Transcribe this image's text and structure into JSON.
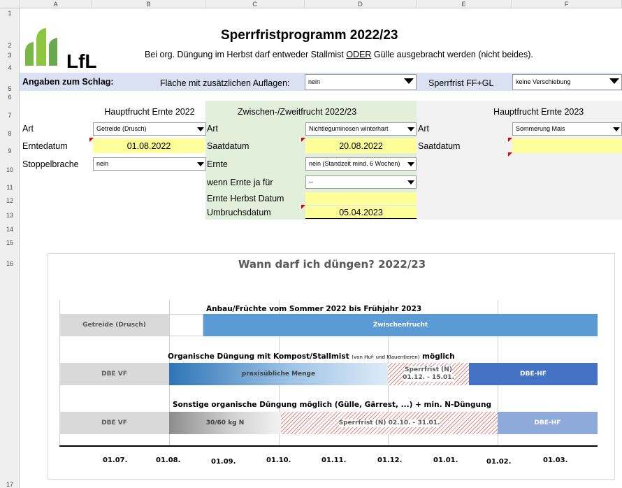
{
  "spreadsheet": {
    "columns": [
      "A",
      "B",
      "C",
      "D",
      "E",
      "F"
    ],
    "rows": [
      "1",
      "2",
      "3",
      "4",
      "5",
      "6",
      "7",
      "8",
      "9",
      "10",
      "11",
      "12",
      "13",
      "14",
      "15",
      "16",
      "17"
    ]
  },
  "header": {
    "logo_text": "LfL",
    "title": "Sperrfristprogramm 2022/23",
    "subtitle_pre": "Bei org. Düngung im Herbst darf entweder Stallmist ",
    "subtitle_em": "ODER",
    "subtitle_post": " Gülle ausgebracht werden (nicht beides)."
  },
  "schlag": {
    "label": "Angaben zum Schlag:",
    "auflagen_label": "Fläche mit zusätzlichen Auflagen:",
    "auflagen_value": "nein",
    "sperrfrist_label": "Sperrfrist FF+GL",
    "sperrfrist_value": "keine Verschiebung"
  },
  "hauptfrucht_2022": {
    "heading": "Hauptfrucht Ernte 2022",
    "art_label": "Art",
    "art_value": "Getreide (Drusch)",
    "erntedatum_label": "Erntedatum",
    "erntedatum_value": "01.08.2022",
    "stoppel_label": "Stoppelbrache",
    "stoppel_value": "nein"
  },
  "zwischenfrucht": {
    "heading": "Zwischen-/Zweitfrucht 2022/23",
    "art_label": "Art",
    "art_value": "Nichtleguminosen winterhart",
    "saatdatum_label": "Saatdatum",
    "saatdatum_value": "20.08.2022",
    "ernte_label": "Ernte",
    "ernte_value": "nein (Standzeit mind. 6 Wochen)",
    "wenn_label": "wenn Ernte ja für",
    "wenn_value": "--",
    "ernte_herbst_label": "Ernte Herbst Datum",
    "ernte_herbst_value": "",
    "umbruch_label": "Umbruchsdatum",
    "umbruch_value": "05.04.2023"
  },
  "hauptfrucht_2023": {
    "heading": "Hauptfrucht Ernte 2023",
    "art_label": "Art",
    "art_value": "Sommerung Mais",
    "saatdatum_label": "Saatdatum",
    "saatdatum_value": ""
  },
  "chart": {
    "title": "Wann darf ich düngen? 2022/23",
    "section1_title": "Anbau/Früchte vom Sommer 2022 bis Frühjahr 2023",
    "section2_title_main": "Organische Düngung mit Kompost/Stallmist ",
    "section2_title_small": "(von Huf- und Klauentieren)",
    "section2_title_end": " möglich",
    "section3_title": "Sonstige organische Düngung möglich (Gülle, Gärrest, ...) + min. N-Düngung",
    "x_ticks": [
      "01.07.",
      "01.08.",
      "01.09.",
      "01.10.",
      "01.11.",
      "01.12.",
      "01.01.",
      "01.02.",
      "01.03."
    ]
  },
  "chart_data": {
    "type": "gantt",
    "title": "Wann darf ich düngen? 2022/23",
    "x_ticks": [
      "01.07.",
      "01.08.",
      "01.09.",
      "01.10.",
      "01.11.",
      "01.12.",
      "01.01.",
      "01.02.",
      "01.03."
    ],
    "rows": [
      {
        "title": "Anbau/Früchte vom Sommer 2022 bis Frühjahr 2023",
        "segments": [
          {
            "label": "Getreide (Drusch)",
            "start": "01.06.",
            "end": "01.08.",
            "color": "#d9d9d9"
          },
          {
            "label": "",
            "start": "01.08.",
            "end": "20.08.",
            "color": "#ffffff"
          },
          {
            "label": "Zwischenfrucht",
            "start": "20.08.",
            "end": "end",
            "color": "#5b9bd5"
          }
        ]
      },
      {
        "title": "Organische Düngung mit Kompost/Stallmist (von Huf- und Klauentieren) möglich",
        "segments": [
          {
            "label": "DBE VF",
            "start": "01.06.",
            "end": "01.08.",
            "color": "#d9d9d9"
          },
          {
            "label": "praxisübliche Menge",
            "start": "01.08.",
            "end": "01.12.",
            "color": "#2e75b6"
          },
          {
            "label": "Sperrfrist (N) 01.12. - 15.01.",
            "start": "01.12.",
            "end": "15.01.",
            "color": "#e38888"
          },
          {
            "label": "DBE-HF",
            "start": "15.01.",
            "end": "end",
            "color": "#4472c4"
          }
        ]
      },
      {
        "title": "Sonstige organische Düngung möglich (Gülle, Gärrest, ...) + min. N-Düngung",
        "segments": [
          {
            "label": "DBE VF",
            "start": "01.06.",
            "end": "01.08.",
            "color": "#d9d9d9"
          },
          {
            "label": "30/60 kg N",
            "start": "01.08.",
            "end": "01.10.",
            "color": "#a6a6a6"
          },
          {
            "label": "Sperrfrist (N) 02.10. - 31.01.",
            "start": "02.10.",
            "end": "31.01.",
            "color": "#e38888"
          },
          {
            "label": "DBE-HF",
            "start": "01.02.",
            "end": "end",
            "color": "#8eaadb"
          }
        ]
      }
    ],
    "labels": {
      "r1_a": "Getreide (Drusch)",
      "r1_c": "Zwischenfrucht",
      "r2_a": "DBE VF",
      "r2_b": "praxisübliche Menge",
      "r2_c1": "Sperrfrist (N)",
      "r2_c2": "01.12. - 15.01.",
      "r2_d": "DBE-HF",
      "r3_a": "DBE VF",
      "r3_b": "30/60 kg N",
      "r3_c": "Sperrfrist (N) 02.10. - 31.01.",
      "r3_d": "DBE-HF"
    }
  }
}
